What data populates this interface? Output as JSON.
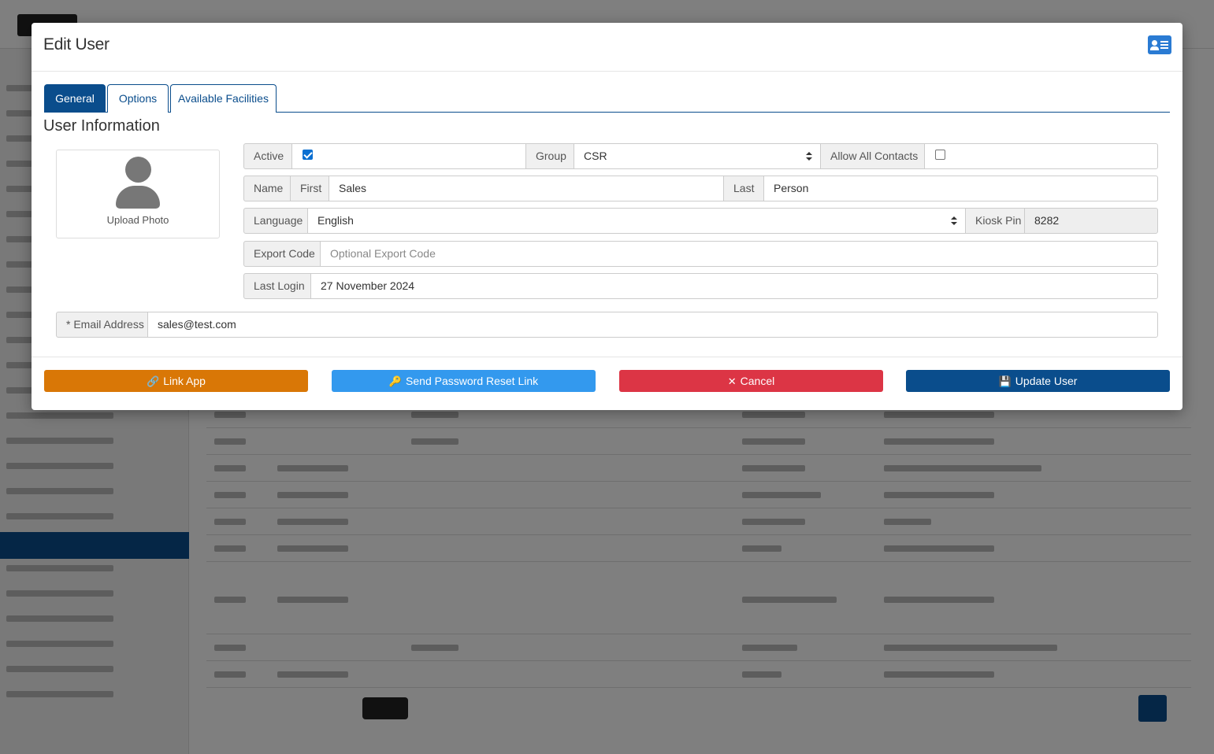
{
  "modal": {
    "title": "Edit User",
    "tabs": [
      {
        "label": "General",
        "active": true
      },
      {
        "label": "Options",
        "active": false
      },
      {
        "label": "Available Facilities",
        "active": false
      }
    ],
    "section_title": "User Information",
    "photo": {
      "label": "Upload Photo"
    },
    "fields": {
      "active": {
        "label": "Active",
        "checked": true
      },
      "group": {
        "label": "Group",
        "value": "CSR"
      },
      "allow_all_contacts": {
        "label": "Allow All Contacts",
        "checked": false
      },
      "name": {
        "label": "Name",
        "first_label": "First",
        "first_value": "Sales",
        "last_label": "Last",
        "last_value": "Person"
      },
      "language": {
        "label": "Language",
        "value": "English"
      },
      "kiosk_pin": {
        "label": "Kiosk Pin",
        "value": "8282"
      },
      "export_code": {
        "label": "Export Code",
        "placeholder": "Optional Export Code"
      },
      "last_login": {
        "label": "Last Login",
        "value": "27 November 2024"
      },
      "email": {
        "label": "* Email Address",
        "value": "sales@test.com"
      }
    },
    "buttons": {
      "link_app": "Link App",
      "send_reset": "Send Password Reset Link",
      "cancel": "Cancel",
      "update": "Update User"
    }
  },
  "colors": {
    "primary": "#0a4d8c",
    "link_app": "#d97706",
    "reset": "#3399ee",
    "cancel": "#dc3545"
  },
  "icons": {
    "header": "contact-card-icon",
    "link_app": "link-icon",
    "send_reset": "key-icon",
    "cancel": "close-icon",
    "update": "save-icon"
  }
}
